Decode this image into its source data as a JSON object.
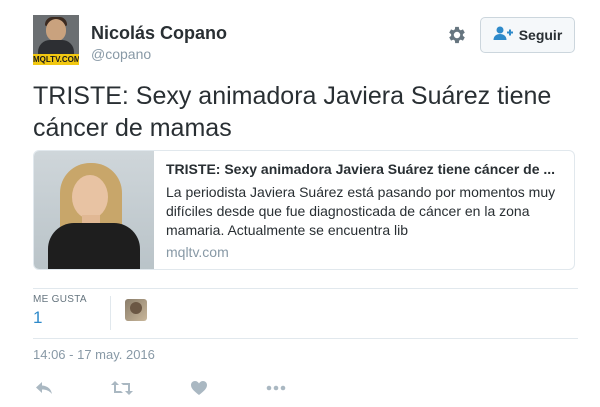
{
  "user": {
    "name": "Nicolás Copano",
    "handle": "@copano",
    "avatar_logo": "MQLTV.COM"
  },
  "header": {
    "settings_icon": "gear-icon",
    "follow_icon": "add-user-icon",
    "follow_label": "Seguir"
  },
  "tweet": {
    "text": "TRISTE: Sexy animadora Javiera Suárez tiene cáncer de mamas"
  },
  "card": {
    "title": "TRISTE: Sexy animadora Javiera Suárez tiene cáncer de ...",
    "description": "La periodista Javiera Suárez está pasando por momentos muy difíciles desde que fue diagnosticada de cáncer en la zona mamaria. Actualmente se encuentra lib",
    "domain": "mqltv.com"
  },
  "stats": {
    "likes_label": "ME GUSTA",
    "likes_count": "1"
  },
  "timestamp": "14:06 - 17 may. 2016",
  "actions": [
    "reply-icon",
    "retweet-icon",
    "like-icon",
    "more-icon"
  ],
  "colors": {
    "link": "#2e8aca",
    "muted": "#8899a6",
    "text": "#292f33",
    "border": "#e1e8ed"
  }
}
